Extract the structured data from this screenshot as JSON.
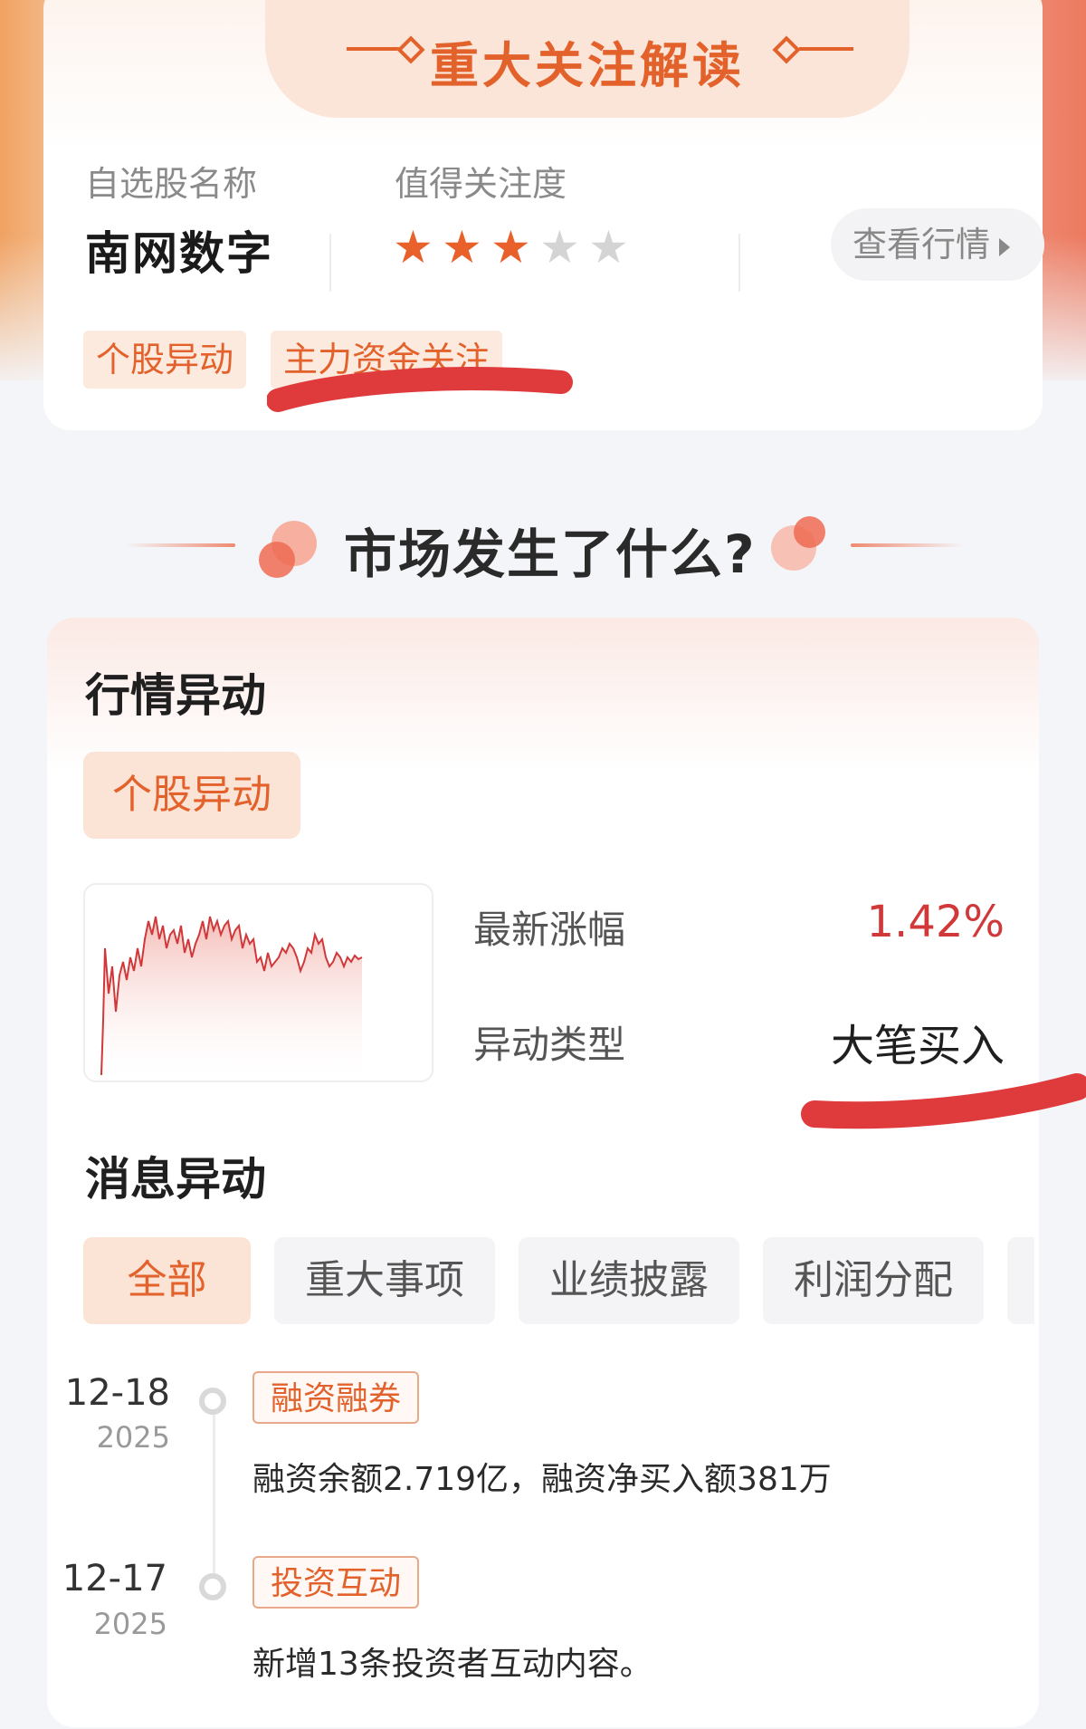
{
  "focus": {
    "title": "重大关注解读",
    "name_label": "自选股名称",
    "attention_label": "值得关注度",
    "stock_name": "南网数字",
    "stars_filled": 3,
    "stars_total": 5,
    "view_button": "查看行情",
    "tags": [
      "个股异动",
      "主力资金关注"
    ]
  },
  "section_title": "市场发生了什么?",
  "market": {
    "heading": "行情异动",
    "tag": "个股异动",
    "latest_change_label": "最新涨幅",
    "latest_change_value": "1.42%",
    "anomaly_type_label": "异动类型",
    "anomaly_type_value": "大笔买入"
  },
  "news": {
    "heading": "消息异动",
    "tabs": [
      "全部",
      "重大事项",
      "业绩披露",
      "利润分配"
    ],
    "items": [
      {
        "date": "12-18",
        "year": "2025",
        "tag": "融资融券",
        "text": "融资余额2.719亿，融资净买入额381万"
      },
      {
        "date": "12-17",
        "year": "2025",
        "tag": "投资互动",
        "text": "新增13条投资者互动内容。"
      }
    ]
  },
  "colors": {
    "accent": "#e3622c",
    "up": "#d0383a",
    "scribble": "#df3a3c",
    "star_on": "#e8612a",
    "star_off": "#d4d4d4"
  }
}
